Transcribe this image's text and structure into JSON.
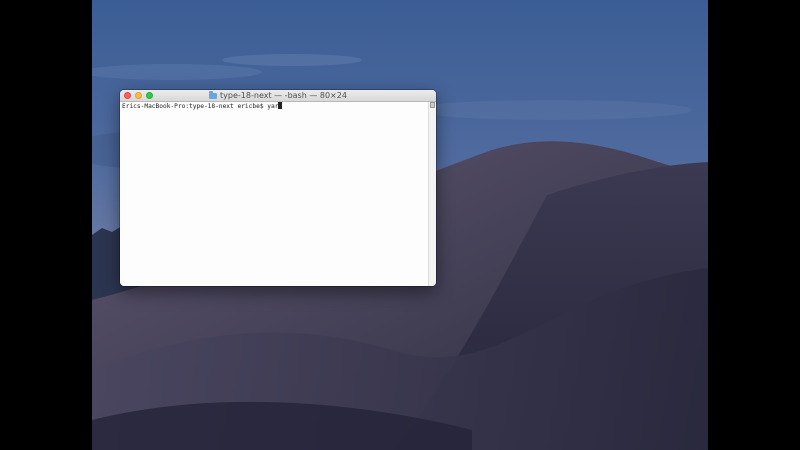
{
  "window": {
    "title": "type-18-next — -bash — 80×24",
    "title_icon": "folder-icon",
    "controls": [
      "close",
      "minimize",
      "zoom"
    ]
  },
  "terminal": {
    "prompt": "Erics-MacBook-Pro:type-18-next ericbe$ ",
    "input": "yar"
  },
  "colors": {
    "close": "#fc605c",
    "minimize": "#fdbc40",
    "zoom": "#34c84a",
    "terminal_bg": "#fdfdfd"
  }
}
